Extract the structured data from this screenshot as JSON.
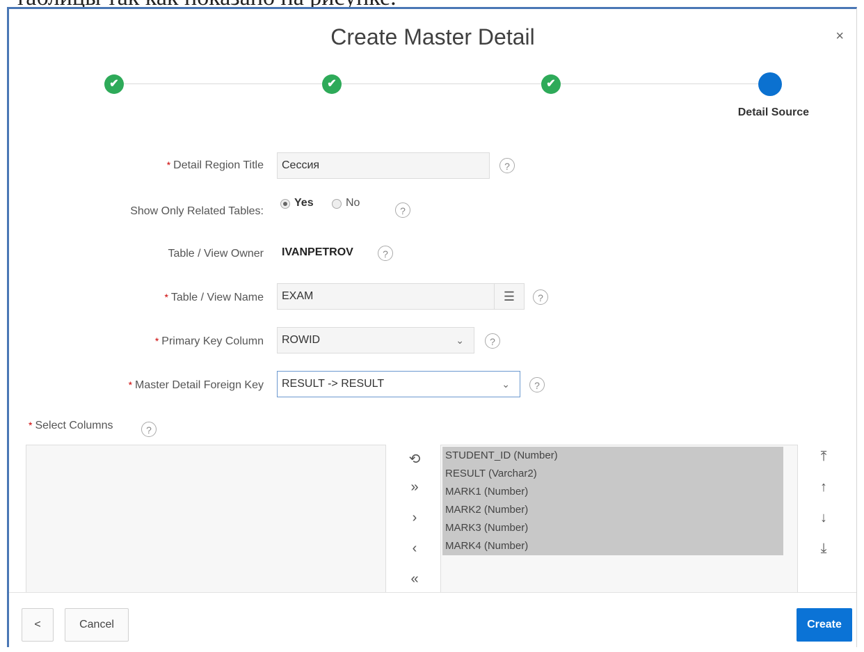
{
  "background_caption": "таблицы так как показано на рисунке.",
  "dialog": {
    "title": "Create Master Detail",
    "close_label": "×"
  },
  "wizard": {
    "steps": [
      {
        "state": "complete",
        "icon": "check-icon",
        "glyph": "✔"
      },
      {
        "state": "complete",
        "icon": "check-icon",
        "glyph": "✔"
      },
      {
        "state": "complete",
        "icon": "check-icon",
        "glyph": "✔"
      },
      {
        "state": "current"
      }
    ],
    "current_label": "Detail Source"
  },
  "form": {
    "required_mark": "*",
    "help_glyph": "?",
    "detail_region_title": {
      "label": "Detail Region Title",
      "value": "Сессия"
    },
    "show_only_related": {
      "label": "Show Only Related Tables:",
      "yes_label": "Yes",
      "no_label": "No",
      "selected": "Yes"
    },
    "owner": {
      "label": "Table / View Owner",
      "value": "IVANPETROV"
    },
    "table_name": {
      "label": "Table / View Name",
      "value": "EXAM",
      "lov_glyph": "☰"
    },
    "primary_key": {
      "label": "Primary Key Column",
      "value": "ROWID",
      "caret": "⌄"
    },
    "foreign_key": {
      "label": "Master Detail Foreign Key",
      "value": "RESULT -> RESULT",
      "caret": "⌄"
    },
    "select_columns": {
      "label": "Select Columns",
      "available": [],
      "selected": [
        "STUDENT_ID (Number)",
        "RESULT (Varchar2)",
        "MARK1 (Number)",
        "MARK2 (Number)",
        "MARK3 (Number)",
        "MARK4 (Number)"
      ],
      "controls": {
        "reset": "⟲",
        "move_all": "»",
        "move": "›",
        "remove": "‹",
        "remove_all": "«"
      },
      "order": {
        "top": "⤒",
        "up": "↑",
        "down": "↓",
        "bottom": "⤓"
      }
    }
  },
  "footer": {
    "back_label": "<",
    "cancel_label": "Cancel",
    "create_label": "Create"
  },
  "colors": {
    "accent": "#0b73d6",
    "complete": "#2eaa59",
    "required": "#cc0000"
  }
}
